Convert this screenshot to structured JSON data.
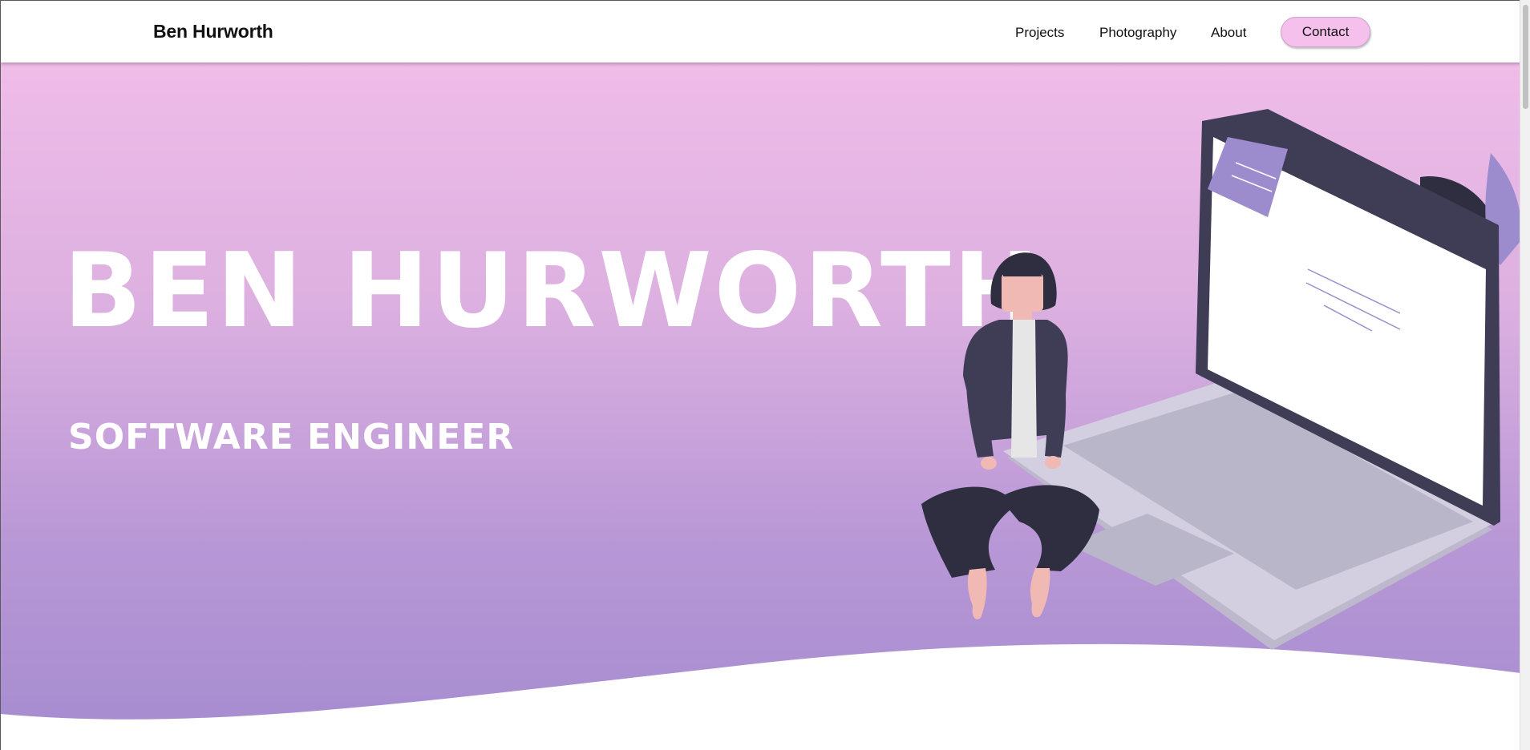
{
  "navbar": {
    "brand": "Ben Hurworth",
    "links": [
      "Projects",
      "Photography",
      "About"
    ],
    "contact_label": "Contact"
  },
  "hero": {
    "title": "BEN HURWORTH",
    "subtitle": "SOFTWARE ENGINEER",
    "illustration": "person-sitting-on-laptop-illustration"
  },
  "colors": {
    "gradient_top": "#f0bce8",
    "gradient_bottom": "#a48ccf",
    "accent_button": "#f5c0ec",
    "illustration_purple": "#9d8ccd",
    "illustration_dark": "#3f3d56"
  }
}
